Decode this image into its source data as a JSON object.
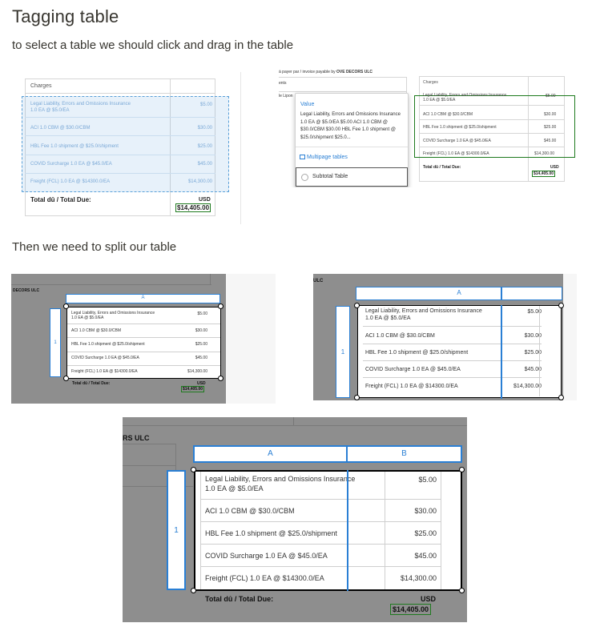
{
  "title": "Tagging table",
  "intro": "to select a table we should click and drag in the table",
  "split_text": "Then we need to split our table",
  "charges_header": "Charges",
  "total_label": "Total dû / Total Due:",
  "currency": "USD",
  "total_amount": "$14,405.00",
  "line_items": [
    {
      "desc": "Legal Liability, Errors and Omissions Insurance 1.0 EA @ $5.0/EA",
      "desc_l1": "Legal Liability, Errors and Omissions Insurance",
      "desc_l2": "1.0 EA @ $5.0/EA",
      "amount": "$5.00"
    },
    {
      "desc": "ACI 1.0 CBM @ $30.0/CBM",
      "amount": "$30.00"
    },
    {
      "desc": "HBL Fee 1.0 shipment @ $25.0/shipment",
      "amount": "$25.00"
    },
    {
      "desc": "COVID Surcharge 1.0 EA @ $45.0/EA",
      "amount": "$45.00"
    },
    {
      "desc": "Freight (FCL) 1.0 EA @ $14300.0/EA",
      "amount": "$14,300.00"
    }
  ],
  "popup": {
    "payable_line": "à payer par / invoice payable by",
    "payer": "OVE DECORS ULC",
    "field_1": "ents",
    "field_2": "le Lipon",
    "value_label": "Value",
    "value_text": "Legal Liability, Errors and Omissions Insurance 1.0 EA @ $5.0/EA $5.00 ACI 1.0 CBM @ $30.0/CBM $30.00 HBL Fee 1.0 shipment @ $25.0/shipment $25.0...",
    "multipage_label": "Multipage tables",
    "subtotal_label": "Subtotal Table"
  },
  "split": {
    "company_short": "DECORS ULC",
    "company_mid": "ULC",
    "company_big": "RS ULC",
    "col_a": "A",
    "col_b": "B",
    "row_1": "1"
  },
  "colors": {
    "selection_blue": "#2a7fd4",
    "total_green": "#1e7a1e",
    "overlay_gray": "#8e8e8e"
  }
}
